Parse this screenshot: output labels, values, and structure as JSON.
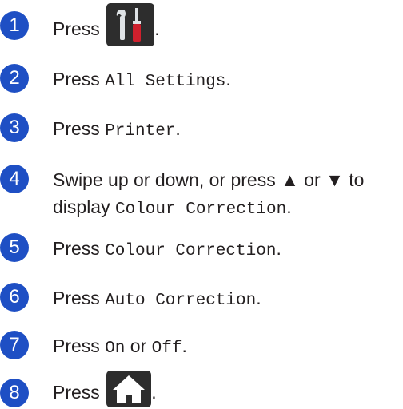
{
  "steps": [
    {
      "number": "1",
      "press": "Press",
      "end": "."
    },
    {
      "number": "2",
      "press": "Press",
      "command": "All Settings",
      "end": "."
    },
    {
      "number": "3",
      "press": "Press",
      "command": "Printer",
      "end": "."
    },
    {
      "number": "4",
      "line1": "Swipe up or down, or press ▲ or ▼ to",
      "line2_prefix": "display",
      "command": "Colour Correction",
      "end": "."
    },
    {
      "number": "5",
      "press": "Press",
      "command": "Colour Correction",
      "end": "."
    },
    {
      "number": "6",
      "press": "Press",
      "command": "Auto Correction",
      "end": "."
    },
    {
      "number": "7",
      "press": "Press",
      "option_on": "On",
      "or": "or",
      "option_off": "Off",
      "end": "."
    },
    {
      "number": "8",
      "press": "Press",
      "end": "."
    }
  ],
  "icons": {
    "settings": "settings-tools-icon",
    "home": "home-icon"
  },
  "colors": {
    "badge": "#1e4fc4",
    "button": "#2d2d2d",
    "wrench": "#dfe3e6",
    "screwdriver": "#cf202d"
  }
}
